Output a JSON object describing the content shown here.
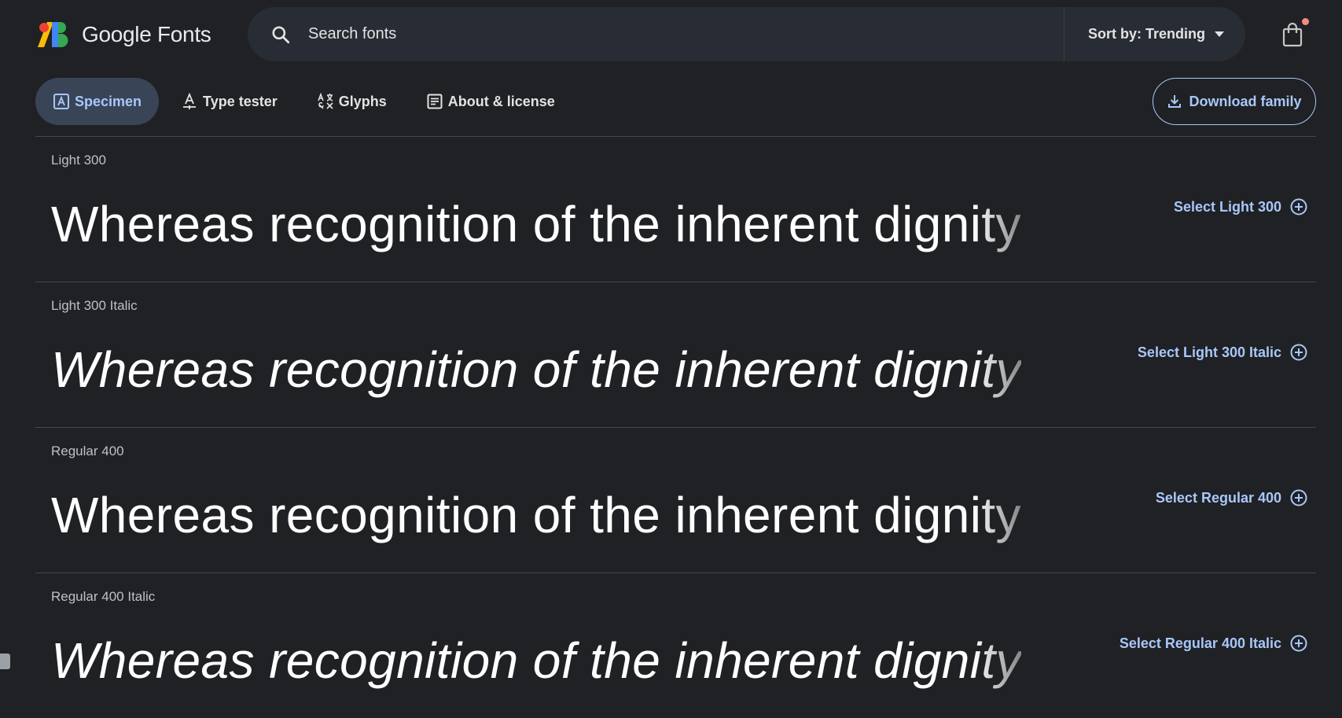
{
  "header": {
    "logo_text": "Google Fonts",
    "search": {
      "placeholder": "Search fonts",
      "value": ""
    },
    "sort_label": "Sort by: Trending"
  },
  "tabs": [
    {
      "label": "Specimen",
      "icon": "specimen-icon",
      "active": true
    },
    {
      "label": "Type tester",
      "icon": "type-tester-icon",
      "active": false
    },
    {
      "label": "Glyphs",
      "icon": "glyphs-icon",
      "active": false
    },
    {
      "label": "About & license",
      "icon": "article-icon",
      "active": false
    }
  ],
  "download_label": "Download family",
  "styles": [
    {
      "label": "Light 300",
      "sample": "Whereas recognition of the inherent dignity",
      "select_label": "Select Light 300"
    },
    {
      "label": "Light 300 Italic",
      "sample": "Whereas recognition of the inherent dignity",
      "select_label": "Select Light 300 Italic"
    },
    {
      "label": "Regular 400",
      "sample": "Whereas recognition of the inherent dignity",
      "select_label": "Select Regular 400"
    },
    {
      "label": "Regular 400 Italic",
      "sample": "Whereas recognition of the inherent dignity",
      "select_label": "Select Regular 400 Italic"
    }
  ],
  "colors": {
    "background": "#202124",
    "search_background": "#282c34",
    "accent": "#a8c7fa",
    "active_tab": "#394457",
    "notification_dot": "#f28b82"
  }
}
